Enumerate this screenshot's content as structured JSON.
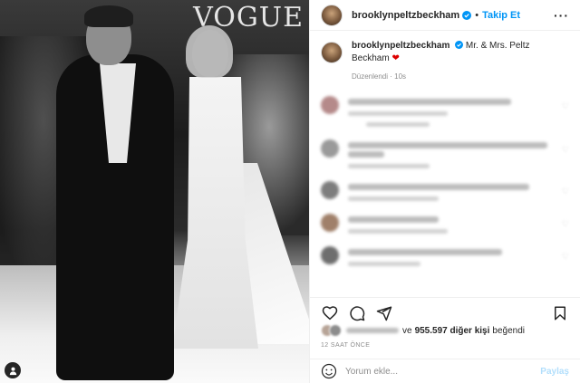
{
  "photo": {
    "watermark": "VOGUE"
  },
  "header": {
    "username": "brooklynpeltzbeckham",
    "separator": "•",
    "follow_label": "Takip Et",
    "more_label": "···"
  },
  "caption": {
    "username": "brooklynpeltzbeckham",
    "text": "Mr. & Mrs. Peltz Beckham",
    "heart": "❤",
    "edited": "Düzenlendi · 10s"
  },
  "comments_count_visible": 5,
  "likes": {
    "prefix": "ve",
    "count": "955.597 diğer kişi",
    "suffix": "beğendi"
  },
  "timestamp": "12 SAAT ÖNCE",
  "add_comment": {
    "placeholder": "Yorum ekle...",
    "share_label": "Paylaş"
  },
  "colors": {
    "accent": "#0095f6",
    "verified": "#0095f6",
    "share_disabled": "#b2dffc",
    "heart": "#dd0000"
  },
  "icons": [
    "verified-badge-icon",
    "more-options-icon",
    "like-heart-icon",
    "comment-icon",
    "share-direct-icon",
    "save-bookmark-icon",
    "emoji-icon",
    "user-tag-icon"
  ]
}
